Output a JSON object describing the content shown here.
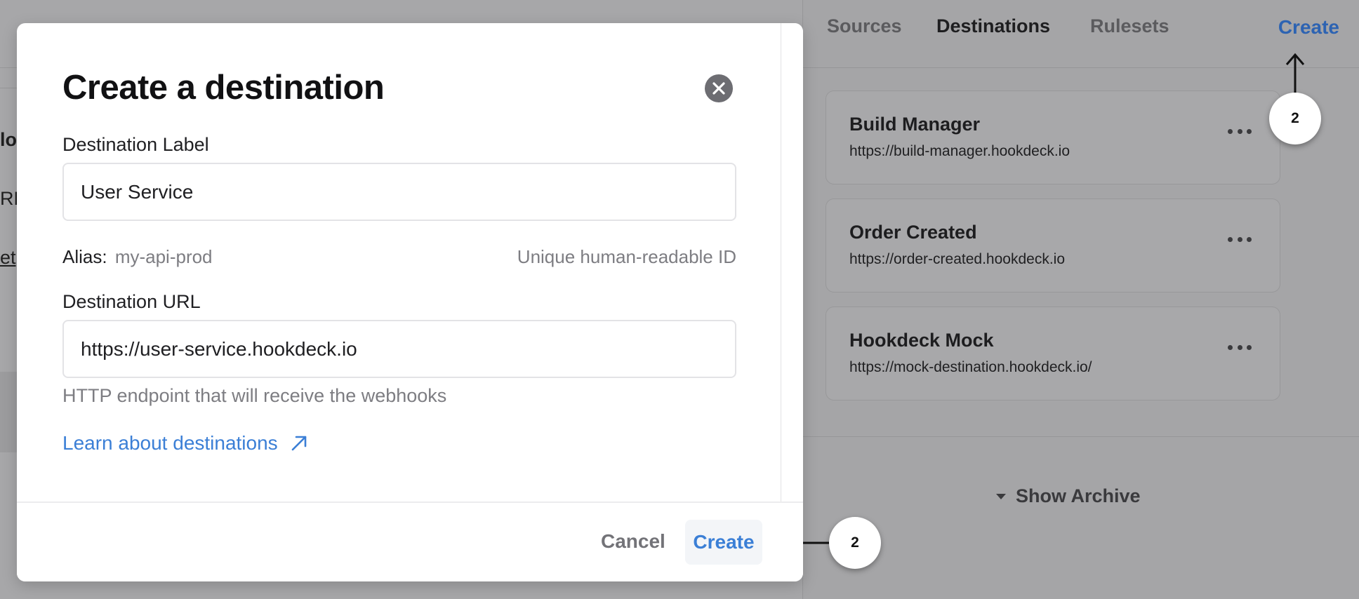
{
  "background": {
    "left_fragments": [
      "lo",
      "RL",
      "et"
    ],
    "nav_tabs": [
      {
        "label": "Sources",
        "active": false
      },
      {
        "label": "Destinations",
        "active": true
      },
      {
        "label": "Rulesets",
        "active": false
      }
    ],
    "create_label": "Create",
    "destinations": [
      {
        "name": "Build Manager",
        "url": "https://build-manager.hookdeck.io"
      },
      {
        "name": "Order Created",
        "url": "https://order-created.hookdeck.io"
      },
      {
        "name": "Hookdeck Mock",
        "url": "https://mock-destination.hookdeck.io/"
      }
    ],
    "show_archive_label": "Show Archive"
  },
  "modal": {
    "title": "Create a destination",
    "label_field": {
      "label": "Destination Label",
      "value": "User Service"
    },
    "alias": {
      "key": "Alias:",
      "value": "my-api-prod",
      "hint": "Unique human-readable ID"
    },
    "url_field": {
      "label": "Destination URL",
      "value": "https://user-service.hookdeck.io",
      "help": "HTTP endpoint that will receive the webhooks"
    },
    "learn_link": "Learn about destinations",
    "cancel_label": "Cancel",
    "create_label": "Create"
  },
  "callouts": {
    "top_number": "2",
    "bottom_number": "2"
  },
  "colors": {
    "accent": "#3b7fd6",
    "overlay": "#a6a6a8",
    "close_button": "#6d6d72"
  },
  "icons": [
    "close-icon",
    "external-link-arrow-icon",
    "more-dots-icon",
    "caret-down-icon",
    "arrow-up-icon",
    "arrow-left-icon"
  ]
}
